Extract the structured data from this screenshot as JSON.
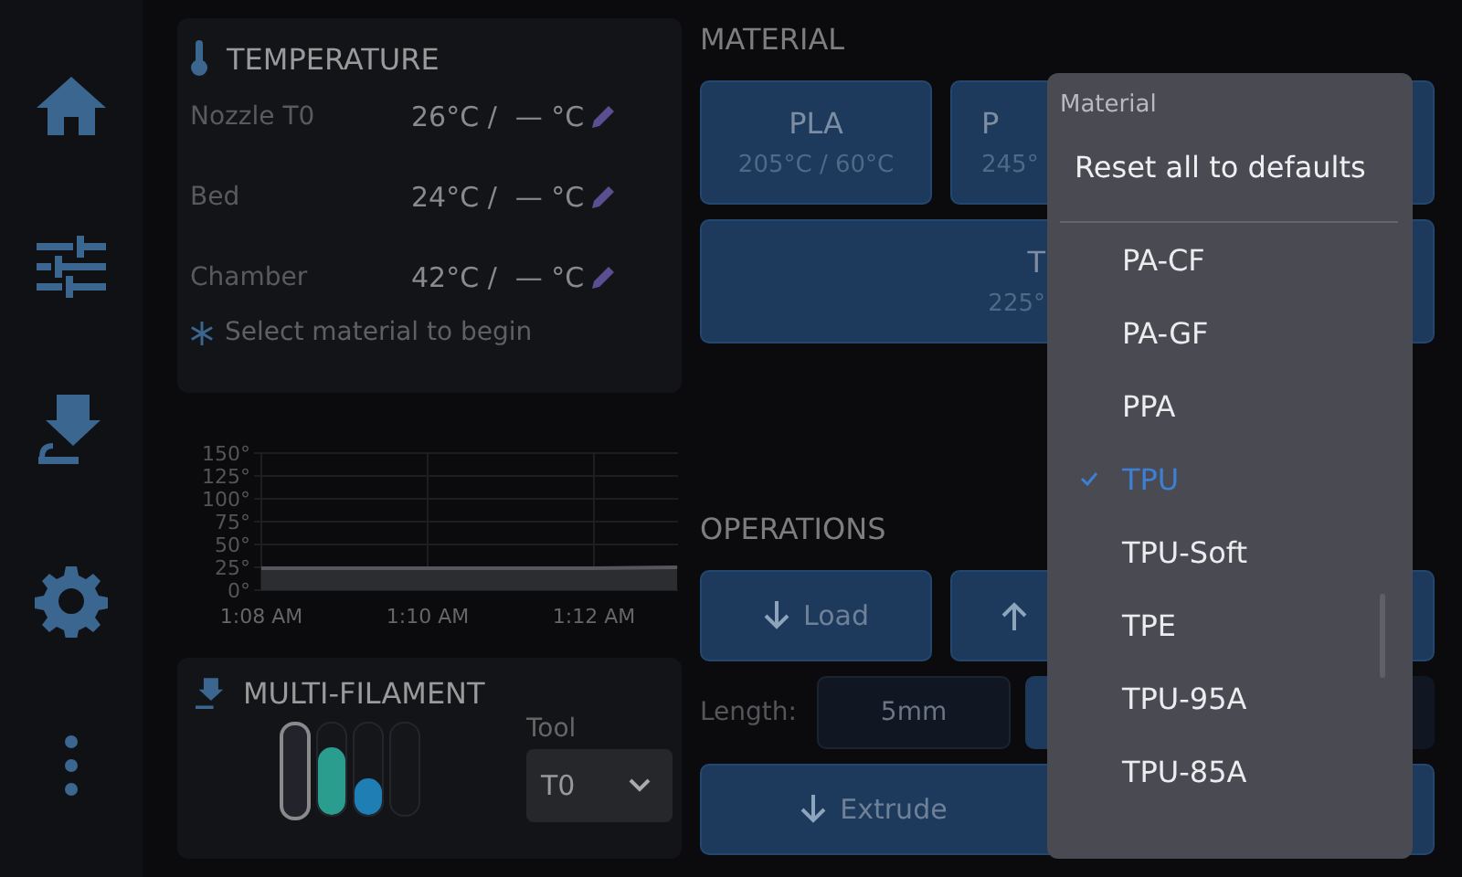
{
  "nav": [
    {
      "kind": "home"
    },
    {
      "kind": "sliders"
    },
    {
      "kind": "filament"
    },
    {
      "kind": "gear"
    },
    {
      "kind": "more"
    }
  ],
  "temperature": {
    "title": "TEMPERATURE",
    "rows": [
      {
        "label": "Nozzle T0",
        "current": "26°C /",
        "target": "— °C"
      },
      {
        "label": "Bed",
        "current": "24°C /",
        "target": "— °C"
      },
      {
        "label": "Chamber",
        "current": "42°C /",
        "target": "— °C"
      }
    ],
    "hint": "Select material to begin"
  },
  "temp_chart": {
    "chart_data": {
      "type": "area",
      "categories": [
        "1:08 AM",
        null,
        "1:10 AM",
        null,
        "1:12 AM",
        null
      ],
      "values": [
        24,
        24,
        24,
        24,
        24,
        25
      ],
      "ylim": [
        0,
        150
      ],
      "grid": true,
      "yticks": [
        {
          "value": 0,
          "label": "0°"
        },
        {
          "value": 25,
          "label": "25°"
        },
        {
          "value": 50,
          "label": "50°"
        },
        {
          "value": 75,
          "label": "75°"
        },
        {
          "value": 100,
          "label": "100°"
        },
        {
          "value": 125,
          "label": "125°"
        },
        {
          "value": 150,
          "label": "150°"
        }
      ]
    }
  },
  "multi_filament": {
    "title": "MULTI-FILAMENT",
    "slots": [
      {
        "selected": true
      },
      {
        "level": 0.75,
        "color": "#2a9d8f",
        "selected": false
      },
      {
        "level": 0.4,
        "color": "#1f7fb5",
        "selected": false
      },
      {
        "selected": false
      }
    ],
    "tool_label": "Tool",
    "tool_value": "T0"
  },
  "material": {
    "title": "MATERIAL",
    "buttons": [
      {
        "name": "PLA",
        "temps": "205°C / 60°C",
        "kind": "normal"
      },
      {
        "name": "P",
        "temps": "245°",
        "kind": "covered"
      },
      {
        "name": "T",
        "temps": "225°",
        "kind": "wide"
      }
    ]
  },
  "operations": {
    "title": "OPERATIONS",
    "load": "Load",
    "length_label": "Length:",
    "length_value": "5mm",
    "extrude": "Extrude"
  },
  "menu": {
    "header": "Material",
    "reset": "Reset all to defaults",
    "items": [
      {
        "label": "PA-CF",
        "selected": false
      },
      {
        "label": "PA-GF",
        "selected": false
      },
      {
        "label": "PPA",
        "selected": false
      },
      {
        "label": "TPU",
        "selected": true
      },
      {
        "label": "TPU-Soft",
        "selected": false
      },
      {
        "label": "TPE",
        "selected": false
      },
      {
        "label": "TPU-95A",
        "selected": false
      },
      {
        "label": "TPU-85A",
        "selected": false
      }
    ]
  }
}
